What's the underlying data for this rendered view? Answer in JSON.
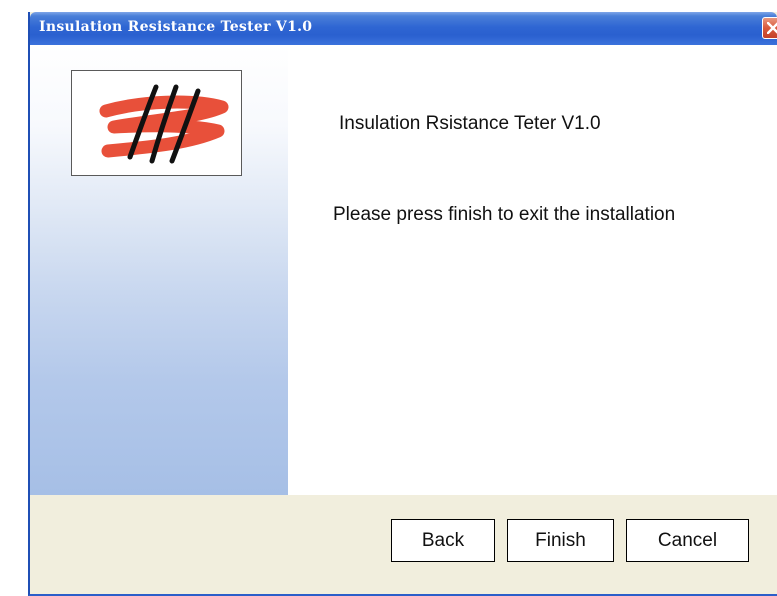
{
  "window": {
    "title": "Insulation Resistance Tester V1.0"
  },
  "main": {
    "heading": "Insulation Rsistance Teter V1.0",
    "message": "Please press finish to exit the installation"
  },
  "buttons": {
    "back_label": "Back",
    "finish_label": "Finish",
    "cancel_label": "Cancel"
  },
  "icons": {
    "close": "close-icon",
    "logo": "logo-icon"
  },
  "colors": {
    "titlebar": "#2f66d3",
    "close_button": "#d8593c",
    "logo_stroke": "#e8503a",
    "button_bar": "#f1eedd"
  }
}
